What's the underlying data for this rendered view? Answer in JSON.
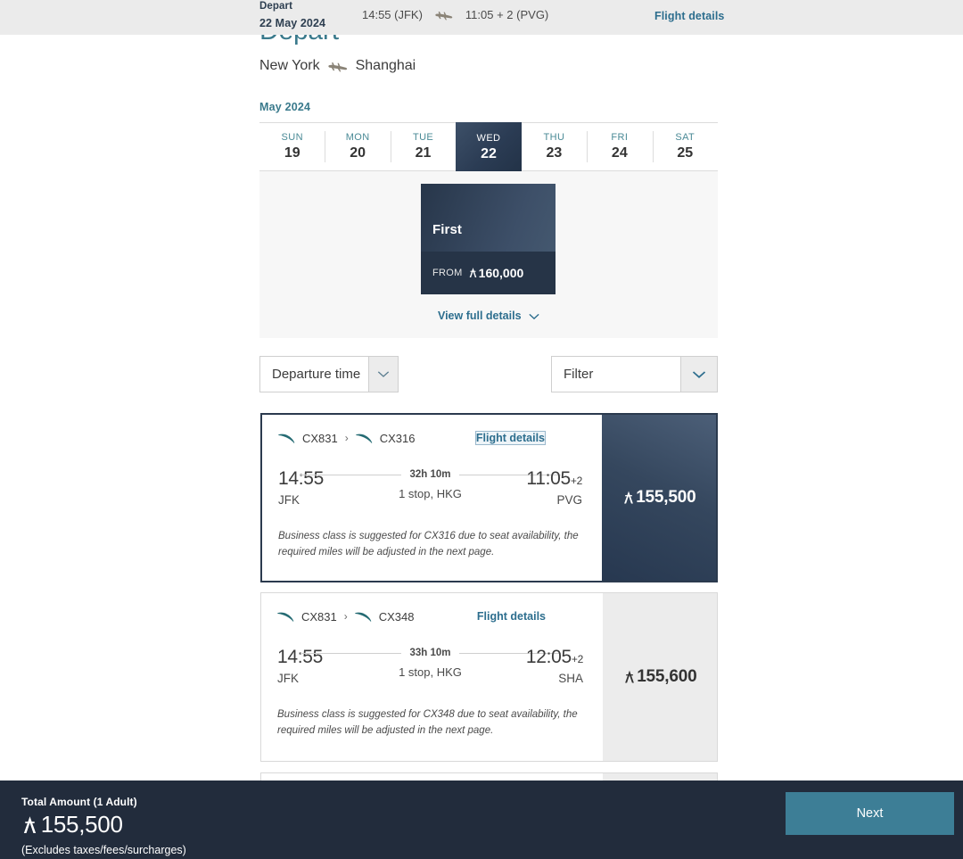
{
  "sticky_header": {
    "depart_label": "Depart",
    "depart_date": "22 May 2024",
    "time_from": "14:55 (JFK)",
    "time_to": "11:05 + 2 (PVG)",
    "flight_details_link": "Flight details",
    "plane_icon": "airplane-icon",
    "bg_color": "#ebebeb"
  },
  "page_heading": {
    "title": "Depart",
    "origin_city": "New York",
    "destination_city": "Shanghai",
    "plane_icon": "airplane-icon",
    "title_color": "#3a7a8c"
  },
  "calendar": {
    "month_label": "May 2024",
    "selected_index": 3,
    "days": [
      {
        "dow": "SUN",
        "num": "19"
      },
      {
        "dow": "MON",
        "num": "20"
      },
      {
        "dow": "TUE",
        "num": "21"
      },
      {
        "dow": "WED",
        "num": "22"
      },
      {
        "dow": "THU",
        "num": "23"
      },
      {
        "dow": "FRI",
        "num": "24"
      },
      {
        "dow": "SAT",
        "num": "25"
      }
    ]
  },
  "cabin": {
    "class_name": "First",
    "from_label": "FROM",
    "price": "160,000",
    "currency_symbol": "asia-miles-icon",
    "view_full_details": "View full details",
    "chevron_icon": "chevron-down-icon"
  },
  "filters": {
    "departure_time_label": "Departure time",
    "filter_label": "Filter",
    "chevron_icon": "chevron-down-icon"
  },
  "flights": [
    {
      "segments": [
        "CX831",
        "CX316"
      ],
      "separator": "›",
      "details_link": "Flight details",
      "details_focused": true,
      "depart_time": "14:55",
      "depart_code": "JFK",
      "duration": "32h 10m",
      "stops": "1 stop, HKG",
      "arrive_time": "11:05",
      "arrive_day_offset": "+2",
      "arrive_code": "PVG",
      "note": "Business class is suggested for CX316 due to seat availability, the required miles will be adjusted in the next page.",
      "price": "155,500",
      "selected": true
    },
    {
      "segments": [
        "CX831",
        "CX348"
      ],
      "separator": "›",
      "details_link": "Flight details",
      "details_focused": false,
      "depart_time": "14:55",
      "depart_code": "JFK",
      "duration": "33h 10m",
      "stops": "1 stop, HKG",
      "arrive_time": "12:05",
      "arrive_day_offset": "+2",
      "arrive_code": "SHA",
      "note": "Business class is suggested for CX348 due to seat availability, the required miles will be adjusted in the next page.",
      "price": "155,600",
      "selected": false
    }
  ],
  "bottom_bar": {
    "total_label": "Total Amount (1 Adult)",
    "total_amount": "155,500",
    "exclusion_note": "(Excludes taxes/fees/surcharges)",
    "next_button": "Next",
    "bg_color": "#222c3c",
    "next_button_color": "#3d7e96"
  }
}
